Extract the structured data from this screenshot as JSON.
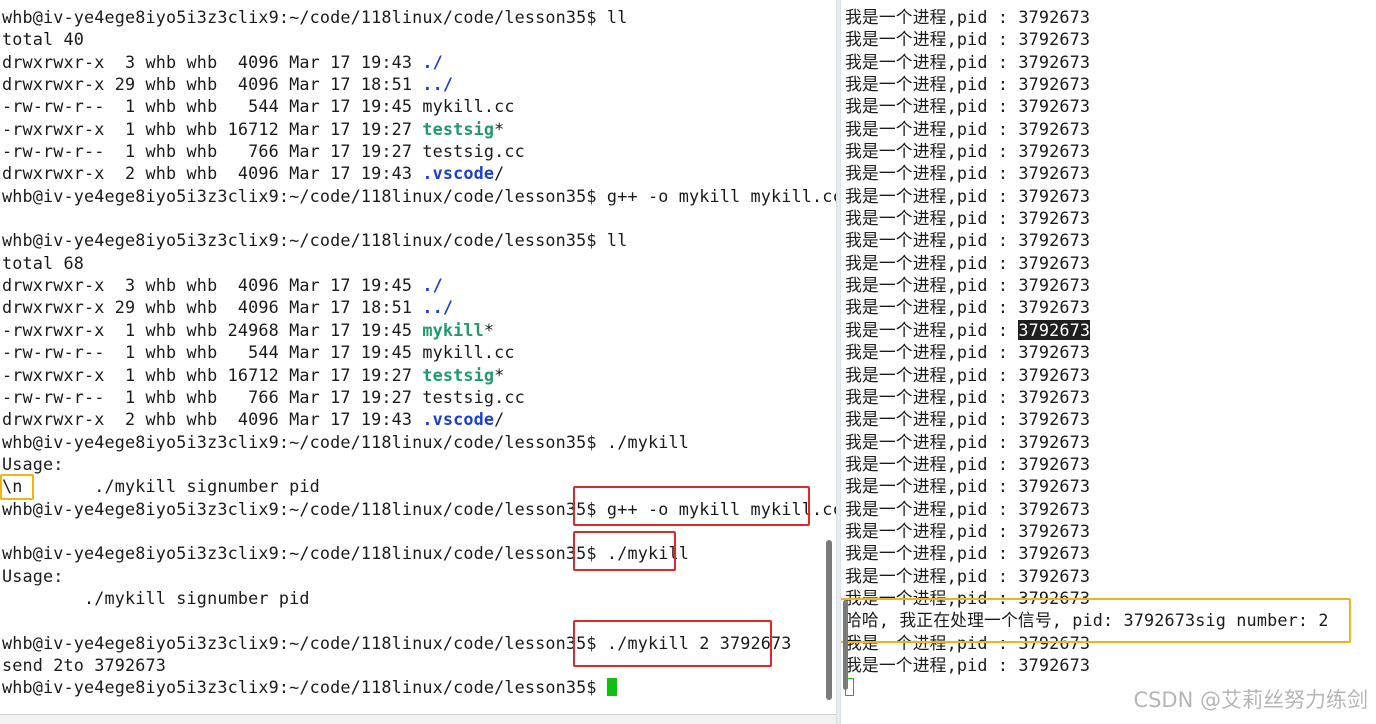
{
  "left_terminal": {
    "lines": [
      {
        "segs": [
          {
            "t": "whb@iv-ye4ege8iyo5i3z3clix9:~/code/118linux/code/lesson35$ ll"
          }
        ]
      },
      {
        "segs": [
          {
            "t": "total 40"
          }
        ]
      },
      {
        "segs": [
          {
            "t": "drwxrwxr-x  3 whb whb  4096 Mar 17 19:43 "
          },
          {
            "t": "./",
            "c": "dir"
          }
        ]
      },
      {
        "segs": [
          {
            "t": "drwxrwxr-x 29 whb whb  4096 Mar 17 18:51 "
          },
          {
            "t": "../",
            "c": "dir"
          }
        ]
      },
      {
        "segs": [
          {
            "t": "-rw-rw-r--  1 whb whb   544 Mar 17 19:45 mykill.cc"
          }
        ]
      },
      {
        "segs": [
          {
            "t": "-rwxrwxr-x  1 whb whb 16712 Mar 17 19:27 "
          },
          {
            "t": "testsig",
            "c": "exec"
          },
          {
            "t": "*"
          }
        ]
      },
      {
        "segs": [
          {
            "t": "-rw-rw-r--  1 whb whb   766 Mar 17 19:27 testsig.cc"
          }
        ]
      },
      {
        "segs": [
          {
            "t": "drwxrwxr-x  2 whb whb  4096 Mar 17 19:43 "
          },
          {
            "t": ".vscode",
            "c": "dir"
          },
          {
            "t": "/"
          }
        ]
      },
      {
        "segs": [
          {
            "t": "whb@iv-ye4ege8iyo5i3z3clix9:~/code/118linux/code/lesson35$ g++ -o mykill mykill.cc"
          }
        ]
      },
      {
        "segs": [
          {
            "t": ""
          }
        ]
      },
      {
        "segs": [
          {
            "t": "whb@iv-ye4ege8iyo5i3z3clix9:~/code/118linux/code/lesson35$ ll"
          }
        ]
      },
      {
        "segs": [
          {
            "t": "total 68"
          }
        ]
      },
      {
        "segs": [
          {
            "t": "drwxrwxr-x  3 whb whb  4096 Mar 17 19:45 "
          },
          {
            "t": "./",
            "c": "dir"
          }
        ]
      },
      {
        "segs": [
          {
            "t": "drwxrwxr-x 29 whb whb  4096 Mar 17 18:51 "
          },
          {
            "t": "../",
            "c": "dir"
          }
        ]
      },
      {
        "segs": [
          {
            "t": "-rwxrwxr-x  1 whb whb 24968 Mar 17 19:45 "
          },
          {
            "t": "mykill",
            "c": "exec"
          },
          {
            "t": "*"
          }
        ]
      },
      {
        "segs": [
          {
            "t": "-rw-rw-r--  1 whb whb   544 Mar 17 19:45 mykill.cc"
          }
        ]
      },
      {
        "segs": [
          {
            "t": "-rwxrwxr-x  1 whb whb 16712 Mar 17 19:27 "
          },
          {
            "t": "testsig",
            "c": "exec"
          },
          {
            "t": "*"
          }
        ]
      },
      {
        "segs": [
          {
            "t": "-rw-rw-r--  1 whb whb   766 Mar 17 19:27 testsig.cc"
          }
        ]
      },
      {
        "segs": [
          {
            "t": "drwxrwxr-x  2 whb whb  4096 Mar 17 19:43 "
          },
          {
            "t": ".vscode",
            "c": "dir"
          },
          {
            "t": "/"
          }
        ]
      },
      {
        "segs": [
          {
            "t": "whb@iv-ye4ege8iyo5i3z3clix9:~/code/118linux/code/lesson35$ ./mykill"
          }
        ]
      },
      {
        "segs": [
          {
            "t": "Usage:"
          }
        ]
      },
      {
        "segs": [
          {
            "t": "\\n       ./mykill signumber pid"
          }
        ]
      },
      {
        "segs": [
          {
            "t": "whb@iv-ye4ege8iyo5i3z3clix9:~/code/118linux/code/lesson35$ g++ -o mykill mykill.cc"
          }
        ]
      },
      {
        "segs": [
          {
            "t": ""
          }
        ]
      },
      {
        "segs": [
          {
            "t": "whb@iv-ye4ege8iyo5i3z3clix9:~/code/118linux/code/lesson35$ ./mykill"
          }
        ]
      },
      {
        "segs": [
          {
            "t": "Usage:"
          }
        ]
      },
      {
        "segs": [
          {
            "t": "        ./mykill signumber pid"
          }
        ]
      },
      {
        "segs": [
          {
            "t": ""
          }
        ]
      },
      {
        "segs": [
          {
            "t": "whb@iv-ye4ege8iyo5i3z3clix9:~/code/118linux/code/lesson35$ ./mykill 2 3792673"
          }
        ]
      },
      {
        "segs": [
          {
            "t": "send 2to 3792673"
          }
        ]
      },
      {
        "segs": [
          {
            "t": "whb@iv-ye4ege8iyo5i3z3clix9:~/code/118linux/code/lesson35$ "
          },
          {
            "t": "",
            "c": "cursor"
          }
        ]
      }
    ]
  },
  "right_terminal": {
    "lines": [
      {
        "segs": [
          {
            "t": "我是一个进程,pid : 3792673"
          }
        ]
      },
      {
        "segs": [
          {
            "t": "我是一个进程,pid : 3792673"
          }
        ]
      },
      {
        "segs": [
          {
            "t": "我是一个进程,pid : 3792673"
          }
        ]
      },
      {
        "segs": [
          {
            "t": "我是一个进程,pid : 3792673"
          }
        ]
      },
      {
        "segs": [
          {
            "t": "我是一个进程,pid : 3792673"
          }
        ]
      },
      {
        "segs": [
          {
            "t": "我是一个进程,pid : 3792673"
          }
        ]
      },
      {
        "segs": [
          {
            "t": "我是一个进程,pid : 3792673"
          }
        ]
      },
      {
        "segs": [
          {
            "t": "我是一个进程,pid : 3792673"
          }
        ]
      },
      {
        "segs": [
          {
            "t": "我是一个进程,pid : 3792673"
          }
        ]
      },
      {
        "segs": [
          {
            "t": "我是一个进程,pid : 3792673"
          }
        ]
      },
      {
        "segs": [
          {
            "t": "我是一个进程,pid : 3792673"
          }
        ]
      },
      {
        "segs": [
          {
            "t": "我是一个进程,pid : 3792673"
          }
        ]
      },
      {
        "segs": [
          {
            "t": "我是一个进程,pid : 3792673"
          }
        ]
      },
      {
        "segs": [
          {
            "t": "我是一个进程,pid : 3792673"
          }
        ]
      },
      {
        "segs": [
          {
            "t": "我是一个进程,pid : "
          },
          {
            "t": "3792673",
            "c": "sel"
          }
        ]
      },
      {
        "segs": [
          {
            "t": "我是一个进程,pid : 3792673"
          }
        ]
      },
      {
        "segs": [
          {
            "t": "我是一个进程,pid : 3792673"
          }
        ]
      },
      {
        "segs": [
          {
            "t": "我是一个进程,pid : 3792673"
          }
        ]
      },
      {
        "segs": [
          {
            "t": "我是一个进程,pid : 3792673"
          }
        ]
      },
      {
        "segs": [
          {
            "t": "我是一个进程,pid : 3792673"
          }
        ]
      },
      {
        "segs": [
          {
            "t": "我是一个进程,pid : 3792673"
          }
        ]
      },
      {
        "segs": [
          {
            "t": "我是一个进程,pid : 3792673"
          }
        ]
      },
      {
        "segs": [
          {
            "t": "我是一个进程,pid : 3792673"
          }
        ]
      },
      {
        "segs": [
          {
            "t": "我是一个进程,pid : 3792673"
          }
        ]
      },
      {
        "segs": [
          {
            "t": "我是一个进程,pid : 3792673"
          }
        ]
      },
      {
        "segs": [
          {
            "t": "我是一个进程,pid : 3792673"
          }
        ]
      },
      {
        "segs": [
          {
            "t": "我是一个进程,pid : 3792673"
          }
        ]
      },
      {
        "segs": [
          {
            "t": "哈哈, 我正在处理一个信号, pid: 3792673sig number: 2"
          }
        ]
      },
      {
        "segs": [
          {
            "t": "我是一个进程,pid : 3792673"
          }
        ]
      },
      {
        "segs": [
          {
            "t": "我是一个进程,pid : 3792673"
          }
        ]
      },
      {
        "segs": [
          {
            "t": "",
            "c": "hollow"
          }
        ]
      }
    ]
  },
  "watermark": "CSDN @艾莉丝努力练剑",
  "colors": {
    "exec": "#1e9b6a",
    "dir": "#1c3fd1",
    "cursor": "#10c010",
    "highlight_red": "#e0282a",
    "highlight_yellow": "#f3b318"
  }
}
